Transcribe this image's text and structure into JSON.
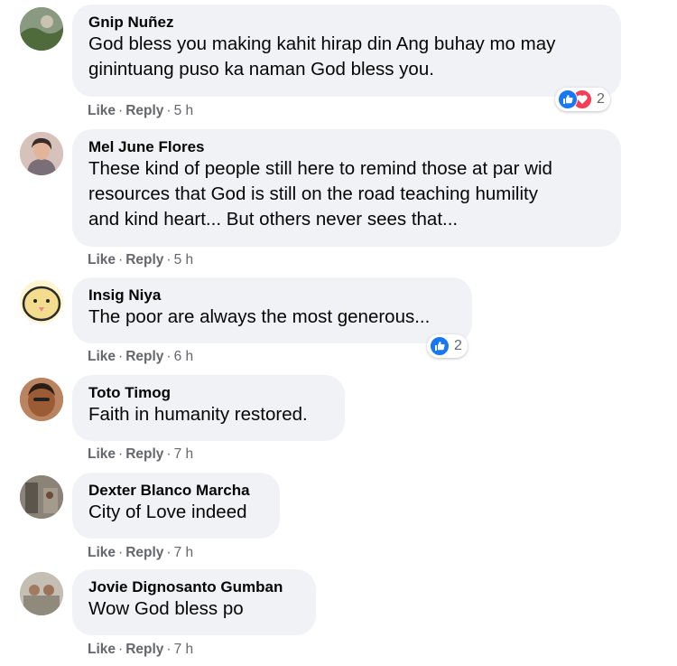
{
  "comments": [
    {
      "author": "Gnip Nuñez",
      "lines": [
        "God bless you making kahit hirap din Ang buhay mo may",
        "ginintuang puso ka naman God bless you."
      ],
      "like": "Like",
      "reply": "Reply",
      "time": "5 h",
      "reactions": {
        "types": [
          "like-icon",
          "love-icon"
        ],
        "count": "2"
      }
    },
    {
      "author": "Mel June Flores",
      "lines": [
        "These kind of people still here to remind those at par wid",
        "resources that God is still on the road teaching humility",
        "and kind heart... But others never sees that..."
      ],
      "like": "Like",
      "reply": "Reply",
      "time": "5 h"
    },
    {
      "author": "Insig Niya",
      "lines": [
        "The poor are always the most generous..."
      ],
      "like": "Like",
      "reply": "Reply",
      "time": "6 h",
      "reactions": {
        "types": [
          "like-icon"
        ],
        "count": "2"
      }
    },
    {
      "author": "Toto Timog",
      "lines": [
        "Faith in humanity restored."
      ],
      "like": "Like",
      "reply": "Reply",
      "time": "7 h"
    },
    {
      "author": "Dexter Blanco Marcha",
      "lines": [
        "City of Love indeed"
      ],
      "like": "Like",
      "reply": "Reply",
      "time": "7 h"
    },
    {
      "author": "Jovie Dignosanto Gumban",
      "lines": [
        "Wow God bless po"
      ],
      "like": "Like",
      "reply": "Reply",
      "time": "7 h"
    }
  ],
  "separator": "·",
  "colors": {
    "bubble": "#f0f2f5",
    "meta_text": "#65676b",
    "like_blue": "#1877f2",
    "love_red": "#f33e58"
  }
}
